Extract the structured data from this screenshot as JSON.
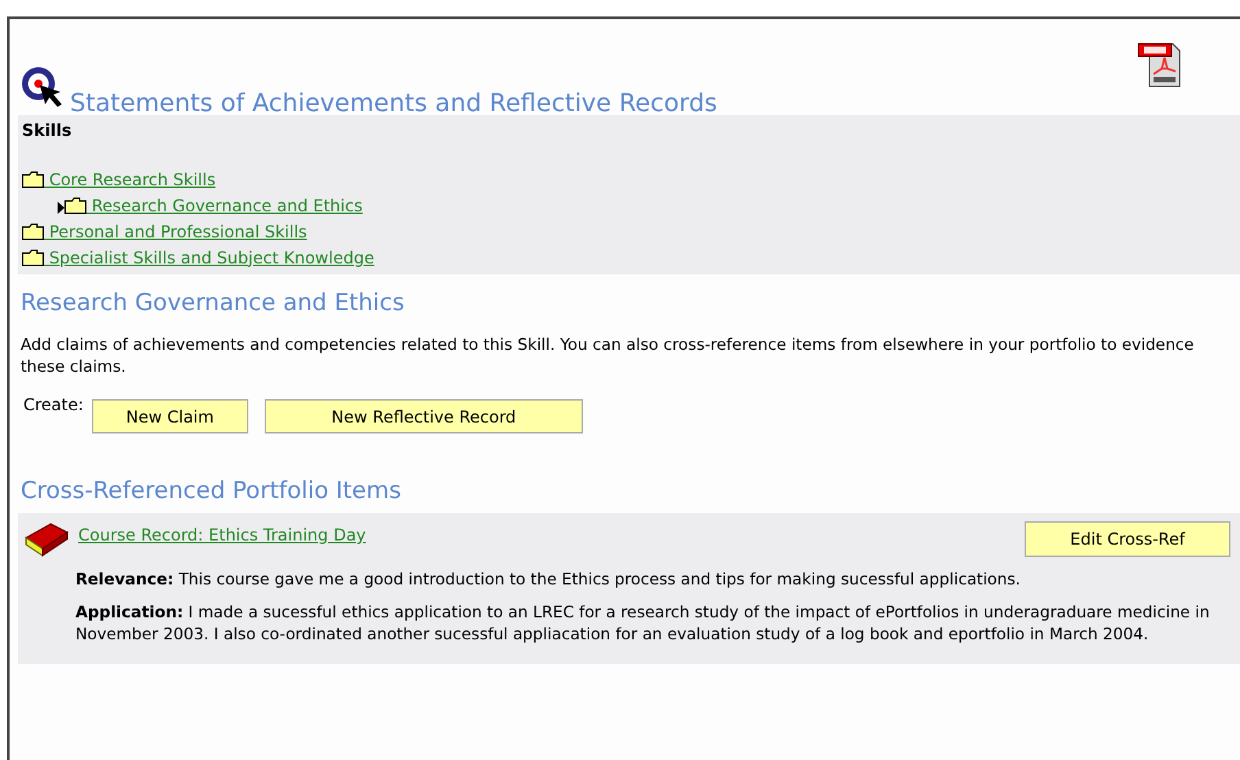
{
  "page": {
    "title": "Statements of Achievements and Reflective Records"
  },
  "skills": {
    "heading": "Skills",
    "items": [
      {
        "label": "Core Research Skills",
        "selected": false,
        "children": [
          {
            "label": "Research Governance and Ethics",
            "selected": true
          }
        ]
      },
      {
        "label": "Personal and Professional Skills",
        "selected": false
      },
      {
        "label": "Specialist Skills and Subject Knowledge",
        "selected": false
      }
    ]
  },
  "section": {
    "title": "Research Governance and Ethics",
    "description": "Add claims of achievements and competencies related to this Skill. You can also cross-reference items from elsewhere in your portfolio to evidence these claims.",
    "create_label": "Create:",
    "buttons": [
      "New Claim",
      "New Reflective Record"
    ]
  },
  "cross_refs": {
    "title": "Cross-Referenced Portfolio Items",
    "items": [
      {
        "link": "Course Record: Ethics Training Day",
        "button": "Edit Cross-Ref",
        "paragraphs": [
          "**Relevance:** This course gave me a good introduction to the Ethics process and tips for making sucessful applications.",
          "**Application:** I made a sucessful ethics application to an LREC for a research study of the impact of ePortfolios in underagraduare medicine in November 2003. I also co-ordinated another sucessful appliacation for an evaluation study of a log book and eportfolio in March 2004."
        ]
      }
    ]
  }
}
